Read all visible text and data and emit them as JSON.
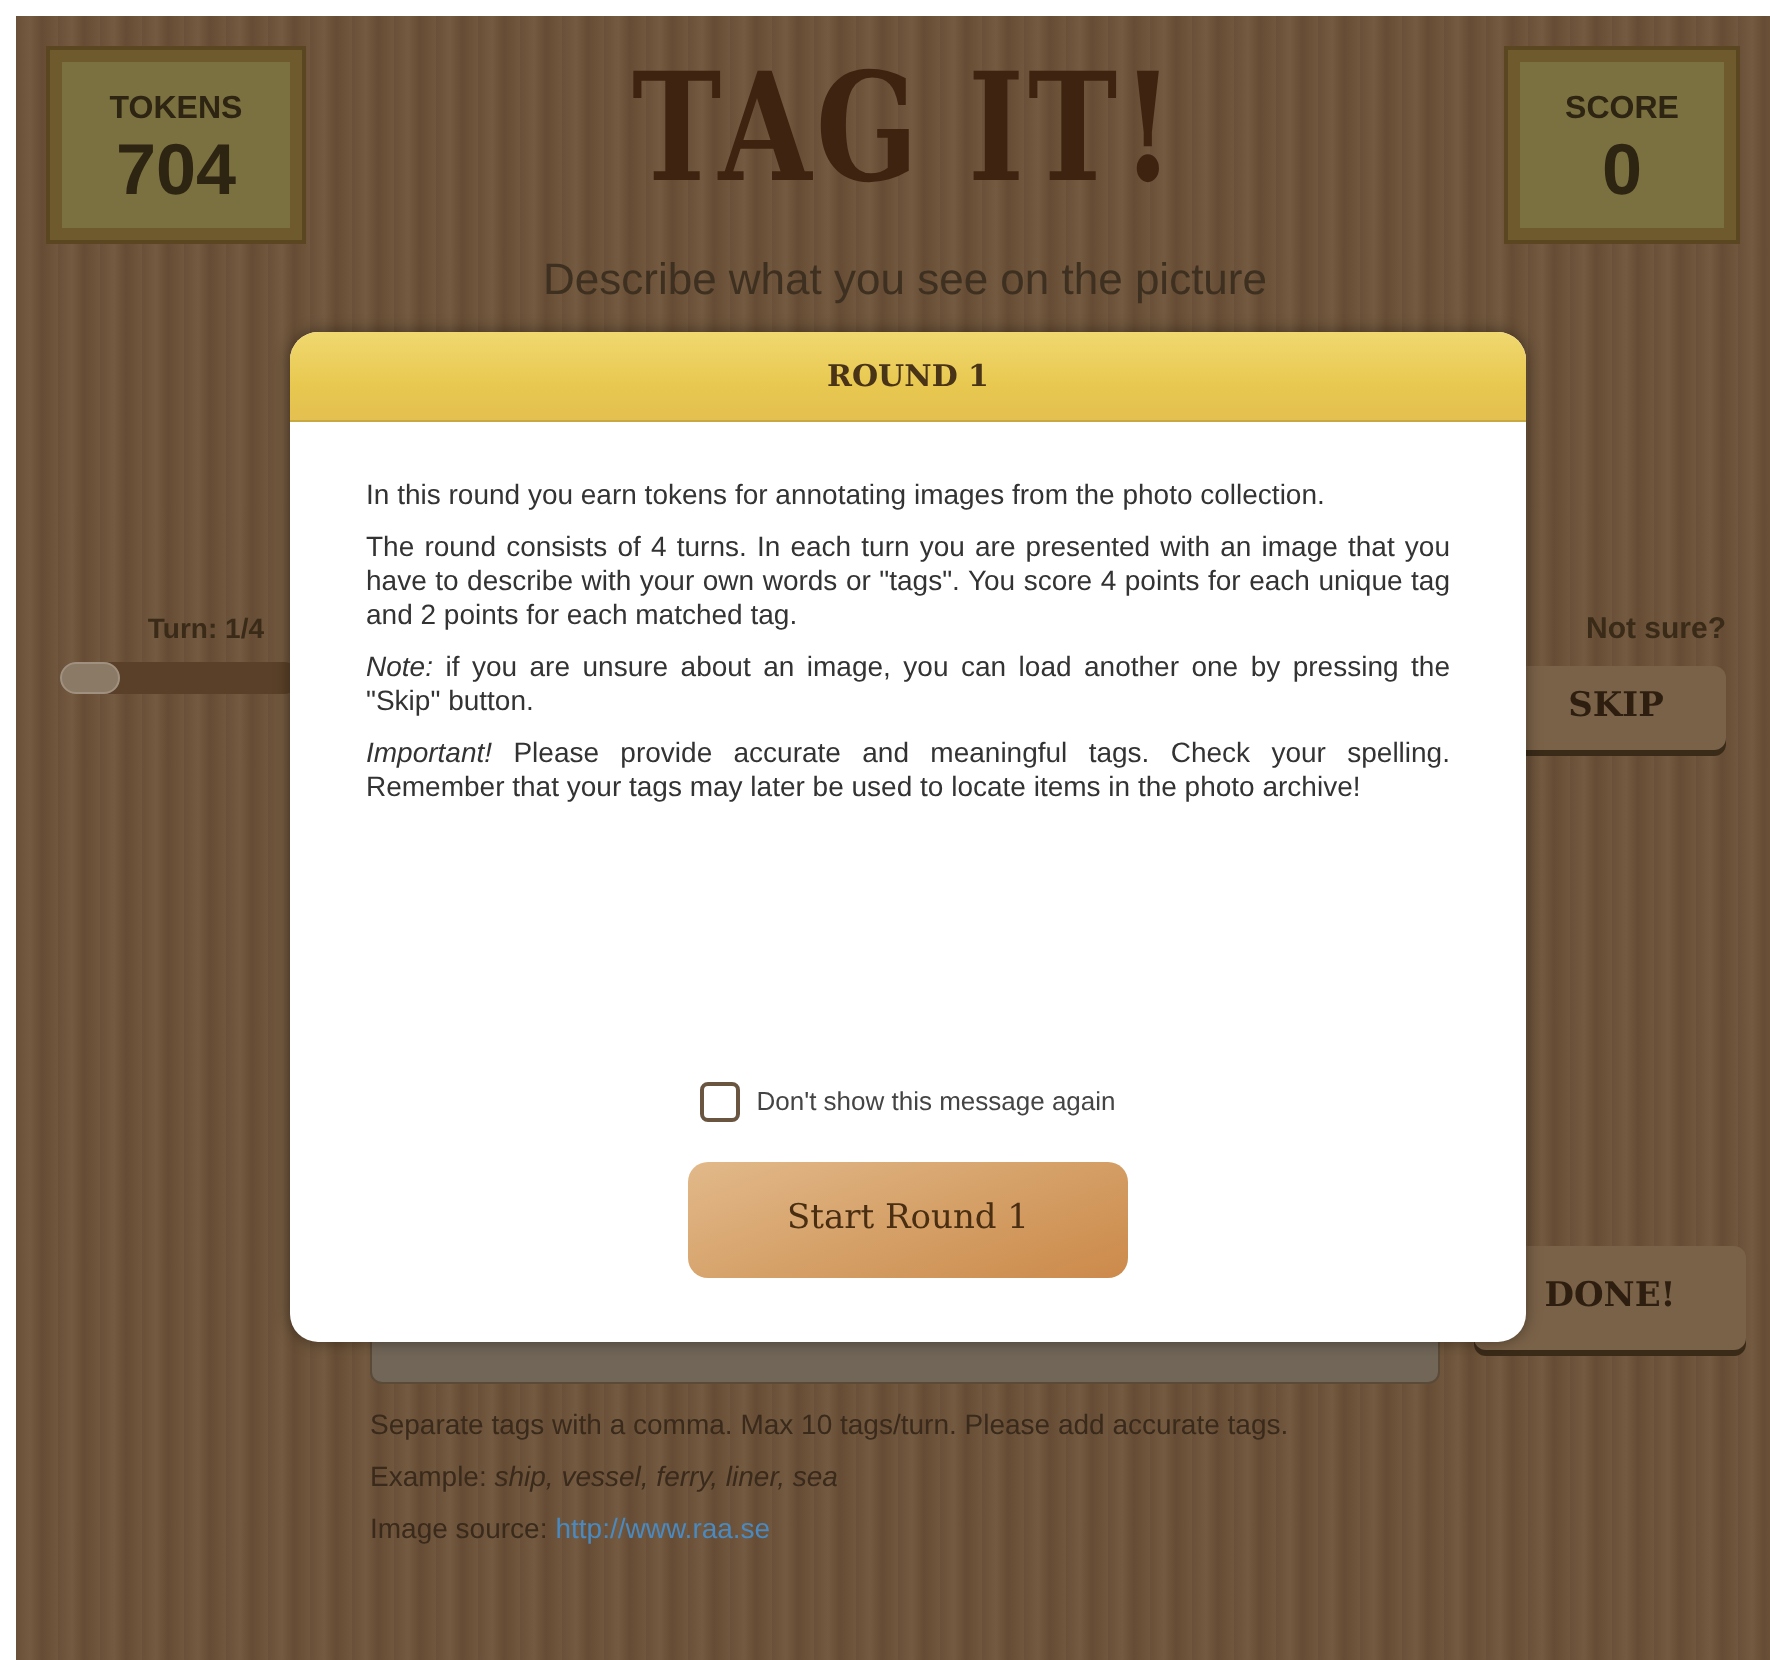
{
  "tokens": {
    "label": "TOKENS",
    "value": "704"
  },
  "title": "TAG IT!",
  "subtitle": "Describe what you see on the picture",
  "turn": {
    "label": "Turn: 1/4",
    "level": 0
  },
  "skip": {
    "label": "Not sure?",
    "button": "SKIP"
  },
  "score": {
    "label": "SCORE",
    "value": "0"
  },
  "done_button": "DONE!",
  "footer": {
    "hint": "Separate tags with a comma. Max 10 tags/turn. Please add accurate tags.",
    "example": "Example: *ship, vessel, ferry, liner, sea*",
    "source_label": "Image source:",
    "source_link": "http://www.raa.se"
  },
  "dialog": {
    "title": "ROUND 1",
    "paragraphs": [
      "In this round you earn tokens for annotating images from the photo collection.",
      "The round consists of 4 turns. In each turn you are presented with an image that you have to describe with your own words or \"tags\". You score 4 points for each unique tag and 2 points for each matched tag.",
      "*Note:* if you are unsure about an image, you can load another one by pressing the \"Skip\" button.",
      "*Important!* Please provide accurate and meaningful tags. Check your spelling. Remember that your tags may later be used to locate items in the photo archive!"
    ],
    "checkbox": {
      "label": "Don't show this message again",
      "checked": false
    },
    "button": "Start Round 1"
  }
}
